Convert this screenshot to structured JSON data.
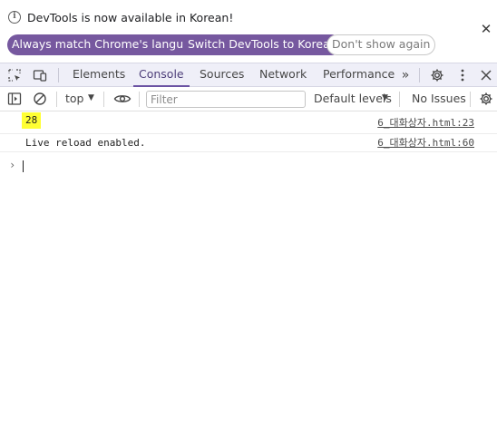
{
  "infobar": {
    "message": "DevTools is now available in Korean!",
    "buttons": {
      "match_language": "Always match Chrome's language",
      "switch_language": "Switch DevTools to Korean",
      "dont_show": "Don't show again"
    },
    "close_icon": "close-icon"
  },
  "tabbar": {
    "tabs": [
      "Elements",
      "Console",
      "Sources",
      "Network",
      "Performance"
    ],
    "active_tab": "Console",
    "more_tabs_glyph": "»",
    "icons": [
      "inspect-element-icon",
      "device-toolbar-icon",
      "more-tabs-icon",
      "settings-icon",
      "more-options-icon",
      "close-icon"
    ]
  },
  "console_toolbar": {
    "context": "top",
    "filter_placeholder": "Filter",
    "filter_value": "",
    "levels": "Default levels",
    "issues": "No Issues",
    "icons": [
      "show-sidebar-icon",
      "clear-console-icon",
      "live-expression-eye-icon",
      "console-settings-icon"
    ]
  },
  "messages": [
    {
      "text": "28",
      "source": "6_대화상자.html:23",
      "highlighted": true
    },
    {
      "text": "Live reload enabled.",
      "source": "6_대화상자.html:60",
      "highlighted": false
    }
  ],
  "prompt": {
    "chevron": "›",
    "value": ""
  },
  "colors": {
    "accent": "#6b53a3",
    "button_bg": "#76589f",
    "toolbar_bg": "#efeff8",
    "highlight": "#ffff33"
  }
}
